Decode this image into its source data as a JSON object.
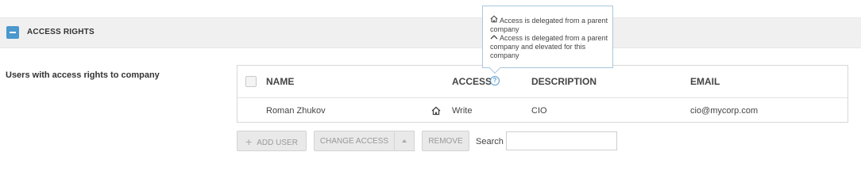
{
  "section": {
    "title": "ACCESS RIGHTS"
  },
  "users_label": "Users with access rights to company",
  "table": {
    "headers": {
      "name": "NAME",
      "access": "ACCESS",
      "description": "DESCRIPTION",
      "email": "EMAIL"
    },
    "rows": [
      {
        "name": "Roman Zhukov",
        "access_icon": "house-icon",
        "access": "Write",
        "description": "CIO",
        "email": "cio@mycorp.com"
      }
    ]
  },
  "buttons": {
    "add_user": "ADD USER",
    "change_access": "CHANGE ACCESS",
    "remove": "REMOVE"
  },
  "search": {
    "label": "Search",
    "value": ""
  },
  "tooltip": {
    "delegated_icon": "house-icon",
    "delegated": "Access is delegated from a parent company",
    "elevated_icon": "chevron-up-icon",
    "elevated": "Access is delegated from a parent company and elevated for this company"
  }
}
